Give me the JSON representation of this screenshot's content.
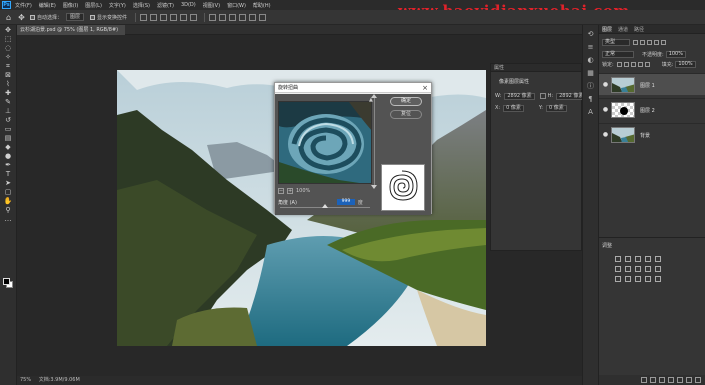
{
  "menubar": {
    "items": [
      "文件(F)",
      "编辑(E)",
      "图像(I)",
      "图层(L)",
      "文字(Y)",
      "选择(S)",
      "滤镜(T)",
      "3D(D)",
      "视图(V)",
      "窗口(W)",
      "帮助(H)"
    ]
  },
  "watermark": "www.haoyidianxuehai.com",
  "options": {
    "auto_select_label": "自动选择：",
    "auto_select_value": "图层",
    "show_transform_label": "显示变换控件"
  },
  "document": {
    "tab_title": "云杉湖泊景.psd @ 75% (图层 1, RGB/8#)",
    "status_zoom": "75%",
    "status_doc": "文档:3.9M/9.06M"
  },
  "dialog": {
    "title": "旋转扭曲",
    "ok_label": "确定",
    "reset_label": "复位",
    "zoom": "100%",
    "angle_label": "角度 (A)",
    "angle_value": "999",
    "angle_unit": "度"
  },
  "properties": {
    "header": "属性",
    "title": "像素图层属性",
    "w_label": "W:",
    "w_value": "2892 像素",
    "h_label": "H:",
    "h_value": "2892 像素",
    "x_label": "X:",
    "x_value": "0 像素",
    "y_label": "Y:",
    "y_value": "0 像素"
  },
  "layers_panel": {
    "tabs": [
      "图层",
      "通道",
      "路径"
    ],
    "filter_kind": "类型",
    "blend_mode": "正常",
    "opacity_label": "不透明度:",
    "opacity_value": "100%",
    "lock_label": "锁定:",
    "fill_label": "填充:",
    "fill_value": "100%",
    "layers": [
      {
        "name": "图层 1",
        "selected": true
      },
      {
        "name": "图层 2",
        "selected": false
      },
      {
        "name": "背景",
        "selected": false
      }
    ]
  },
  "adjustments": {
    "title": "调整"
  }
}
